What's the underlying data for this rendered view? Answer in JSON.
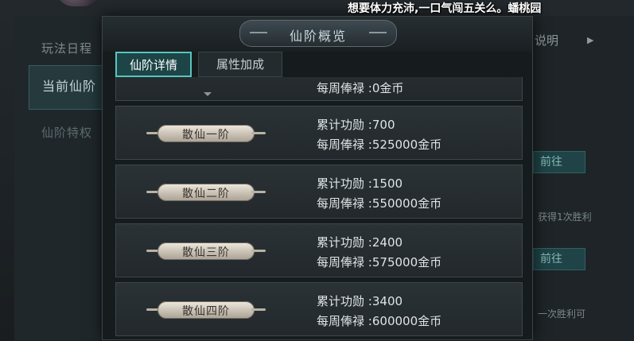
{
  "background": {
    "schedule_label": "玩法日程",
    "current_tier_label": "当前仙阶",
    "privilege_label": "仙阶特权",
    "explain_label": "说明",
    "goto_labels": [
      "前往",
      "前往"
    ],
    "notes": [
      "获得1次胜利",
      "一次胜利可"
    ]
  },
  "subtitle": "想要体力充沛,一口气闯五关么。蟠桃园",
  "modal": {
    "title": "仙阶概览",
    "tabs": [
      {
        "label": "仙阶详情",
        "active": true
      },
      {
        "label": "属性加成",
        "active": false
      }
    ]
  },
  "rows": [
    {
      "tier": "",
      "merit_label": "",
      "merit": "",
      "salary_label": "每周俸禄",
      "salary": ":0金币"
    },
    {
      "tier": "散仙一阶",
      "merit_label": "累计功勋",
      "merit": ":700",
      "salary_label": "每周俸禄",
      "salary": ":525000金币"
    },
    {
      "tier": "散仙二阶",
      "merit_label": "累计功勋",
      "merit": ":1500",
      "salary_label": "每周俸禄",
      "salary": ":550000金币"
    },
    {
      "tier": "散仙三阶",
      "merit_label": "累计功勋",
      "merit": ":2400",
      "salary_label": "每周俸禄",
      "salary": ":575000金币"
    },
    {
      "tier": "散仙四阶",
      "merit_label": "累计功勋",
      "merit": ":3400",
      "salary_label": "每周俸禄",
      "salary": ":600000金币"
    }
  ],
  "colors": {
    "accent": "#57c6c0",
    "tab_active_bg": "#1d4446",
    "panel_bg": "#161b1e",
    "row_bg": "#2b3236"
  }
}
